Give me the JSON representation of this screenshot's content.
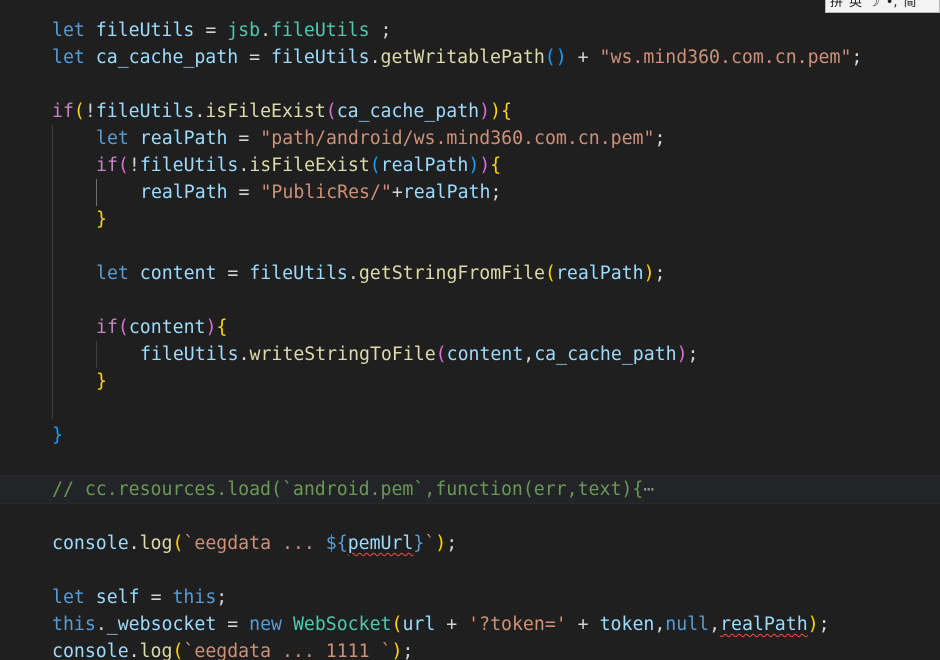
{
  "editor": {
    "theme_colors": {
      "background": "#1f1f1f",
      "keyword": "#569cd6",
      "control": "#c586c0",
      "variable": "#9cdcfe",
      "function": "#dcdcaa",
      "string": "#ce9178",
      "class": "#4ec9b0",
      "comment": "#6a9955"
    },
    "lines": {
      "l1": {
        "kw": "let",
        "t1": " fileUtils ",
        "op": "=",
        "t2": " ",
        "obj": "jsb",
        "dot": ".",
        "prop": "fileUtils",
        "end": " ;"
      },
      "l2": {
        "kw": "let",
        "t1": " ca_cache_path ",
        "op": "=",
        "t2": " ",
        "obj": "fileUtils",
        "dot": ".",
        "fn": "getWritablePath",
        "p": "()",
        "plus": " + ",
        "str": "\"ws.mind360.com.cn.pem\"",
        "end": ";"
      },
      "l4": {
        "ctl": "if",
        "p1": "(",
        "not": "!",
        "obj": "fileUtils",
        "dot": ".",
        "fn": "isFileExist",
        "p2": "(",
        "arg": "ca_cache_path",
        "p3": ")",
        "p4": ")",
        "b": "{"
      },
      "l5": {
        "kw": "let",
        "t1": " realPath ",
        "op": "=",
        "t2": " ",
        "str": "\"path/android/ws.mind360.com.cn.pem\"",
        "end": ";"
      },
      "l6": {
        "ctl": "if",
        "p1": "(",
        "not": "!",
        "obj": "fileUtils",
        "dot": ".",
        "fn": "isFileExist",
        "p2": "(",
        "arg": "realPath",
        "p3": ")",
        "p4": ")",
        "b": "{"
      },
      "l7": {
        "var": "realPath",
        "op": " = ",
        "str": "\"PublicRes/\"",
        "plus": "+",
        "var2": "realPath",
        "end": ";"
      },
      "l8": {
        "b": "}"
      },
      "l10": {
        "kw": "let",
        "t1": " content ",
        "op": "=",
        "t2": " ",
        "obj": "fileUtils",
        "dot": ".",
        "fn": "getStringFromFile",
        "p1": "(",
        "arg": "realPath",
        "p2": ")",
        "end": ";"
      },
      "l12": {
        "ctl": "if",
        "p1": "(",
        "arg": "content",
        "p2": ")",
        "b": "{"
      },
      "l13": {
        "obj": "fileUtils",
        "dot": ".",
        "fn": "writeStringToFile",
        "p1": "(",
        "arg1": "content",
        "comma": ",",
        "arg2": "ca_cache_path",
        "p2": ")",
        "end": ";"
      },
      "l14": {
        "b": "}"
      },
      "l16": {
        "b": "}"
      },
      "l18": {
        "cmt": "// cc.resources.load(`android.pem`,function(err,text){",
        "ellipsis": "⋯"
      },
      "l20": {
        "obj": "console",
        "dot": ".",
        "fn": "log",
        "p1": "(",
        "s1": "`eegdata ... ",
        "i1": "${",
        "var": "pemUrl",
        "i2": "}",
        "s2": "`",
        "p2": ")",
        "end": ";"
      },
      "l22": {
        "kw": "let",
        "t1": " self ",
        "op": "=",
        "t2": " ",
        "this": "this",
        "end": ";"
      },
      "l23": {
        "this": "this",
        "dot": ".",
        "prop": "_websocket",
        "op": " = ",
        "kw": "new",
        "sp": " ",
        "cls": "WebSocket",
        "p1": "(",
        "a1": "url",
        "plus1": " + ",
        "str": "'?token='",
        "plus2": " + ",
        "a2": "token",
        "c1": ",",
        "null": "null",
        "c2": ",",
        "a3": "realPath",
        "p2": ")",
        "end": ";"
      },
      "l24": {
        "obj": "console",
        "dot": ".",
        "fn": "log",
        "p1": "(",
        "str": "`eegdata ... 1111 `",
        "p2": ")",
        "end": ";"
      }
    }
  },
  "ime_toolbar": {
    "items": [
      "拼",
      "英",
      "☽",
      "•,",
      "简"
    ]
  }
}
